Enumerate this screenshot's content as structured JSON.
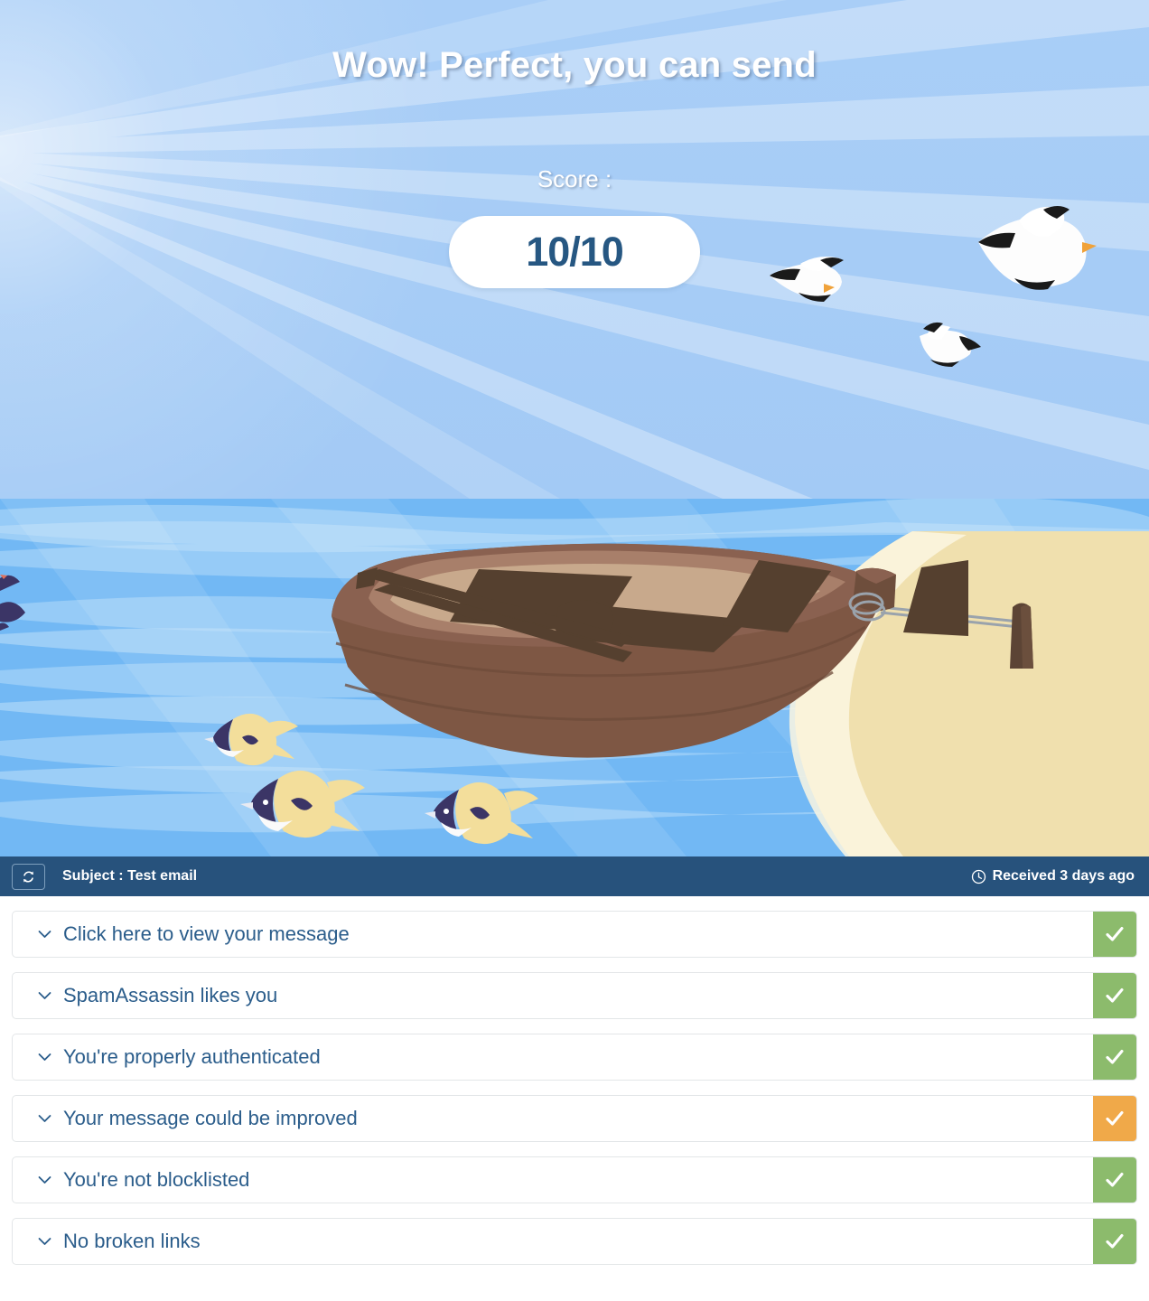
{
  "hero": {
    "title": "Wow! Perfect, you can send",
    "score_label": "Score :",
    "score_value": "10/10",
    "illustration": {
      "scene": "rowboat-on-beach",
      "elements": [
        "sun-rays",
        "seagulls",
        "sea-waves",
        "rowboat",
        "mooring-post",
        "rope",
        "tropical-fish",
        "sand-beach"
      ],
      "seagull_count": 3,
      "fish_count": 3
    }
  },
  "subject_bar": {
    "refresh_icon": "refresh-icon",
    "subject": "Subject : Test email",
    "clock_icon": "clock-icon",
    "received": "Received 3 days ago"
  },
  "checks": {
    "chevron_icon": "chevron-down-icon",
    "check_icon": "check-icon",
    "items": [
      {
        "label": "Click here to view your message",
        "status": "ok"
      },
      {
        "label": "SpamAssassin likes you",
        "status": "ok"
      },
      {
        "label": "You're properly authenticated",
        "status": "ok"
      },
      {
        "label": "Your message could be improved",
        "status": "warn"
      },
      {
        "label": "You're not blocklisted",
        "status": "ok"
      },
      {
        "label": "No broken links",
        "status": "ok"
      }
    ]
  },
  "colors": {
    "sky": "#A8CDF5",
    "sea": "#72B8F4",
    "sand": "#F0E0AE",
    "navy_bar": "#27527C",
    "link_blue": "#2B5D8B",
    "status_ok": "#8CBB6C",
    "status_warn": "#F0A949",
    "score_text": "#265782"
  }
}
